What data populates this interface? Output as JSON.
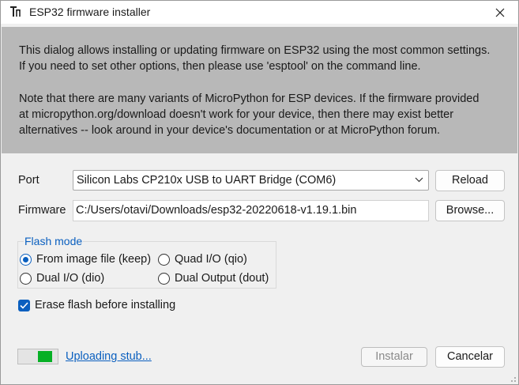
{
  "window": {
    "title": "ESP32 firmware installer",
    "icon": "thonny-app-icon",
    "close_icon": "close-icon"
  },
  "info": {
    "paragraph1_line1": "This dialog allows installing or updating firmware on ESP32 using the most common settings.",
    "paragraph1_line2": "If you need to set other options, then please use 'esptool' on the command line.",
    "paragraph2_line1": "Note that there are many variants of MicroPython for ESP devices. If the firmware provided",
    "paragraph2_line2": "at micropython.org/download doesn't work for your device, then there may exist better",
    "paragraph2_line3": "alternatives -- look around in your device's documentation or at MicroPython forum."
  },
  "port": {
    "label": "Port",
    "selected": "Silicon Labs CP210x USB to UART Bridge (COM6)",
    "reload_label": "Reload"
  },
  "firmware": {
    "label": "Firmware",
    "value": "C:/Users/otavi/Downloads/esp32-20220618-v1.19.1.bin",
    "browse_label": "Browse..."
  },
  "flash_mode": {
    "title": "Flash mode",
    "options": [
      {
        "label": "From image file (keep)",
        "selected": true
      },
      {
        "label": "Quad I/O (qio)",
        "selected": false
      },
      {
        "label": "Dual I/O (dio)",
        "selected": false
      },
      {
        "label": "Dual Output (dout)",
        "selected": false
      }
    ]
  },
  "erase": {
    "label": "Erase flash before installing",
    "checked": true
  },
  "status": {
    "text": "Uploading stub...",
    "progress_fraction": 0.4
  },
  "buttons": {
    "install_label": "Instalar",
    "cancel_label": "Cancelar"
  },
  "colors": {
    "accent": "#0a5fbf",
    "info_bg": "#b8b8b8",
    "progress": "#06b025"
  }
}
